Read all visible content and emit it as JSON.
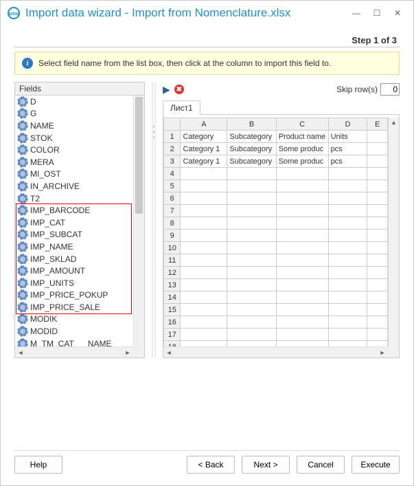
{
  "window": {
    "title": "Import data wizard - Import from Nomenclature.xlsx",
    "step_label": "Step 1 of 3"
  },
  "info": {
    "text": "Select field name from the list box, then click at the column to import this field to."
  },
  "fields": {
    "header": "Fields",
    "items": [
      "D",
      "G",
      "NAME",
      "STOK",
      "COLOR",
      "MERA",
      "MI_OST",
      "IN_ARCHIVE",
      "T2",
      "IMP_BARCODE",
      "IMP_CAT",
      "IMP_SUBCAT",
      "IMP_NAME",
      "IMP_SKLAD",
      "IMP_AMOUNT",
      "IMP_UNITS",
      "IMP_PRICE_POKUP",
      "IMP_PRICE_SALE",
      "MODIK",
      "MODID",
      "M_TM_CAT___NAME"
    ],
    "highlight_start_index": 9,
    "highlight_end_index": 17
  },
  "right": {
    "skip_label": "Skip row(s)",
    "skip_value": "0",
    "tab_label": "Лист1",
    "columns": [
      "A",
      "B",
      "C",
      "D",
      "E"
    ],
    "row_count": 19,
    "rows": [
      {
        "n": 1,
        "cells": [
          "Category",
          "Subcategory",
          "Product name",
          "Units",
          ""
        ]
      },
      {
        "n": 2,
        "cells": [
          "Category 1",
          "Subcategory",
          "Some produc",
          "pcs",
          ""
        ]
      },
      {
        "n": 3,
        "cells": [
          "Category 1",
          "Subcategory",
          "Some produc",
          "pcs",
          ""
        ]
      }
    ]
  },
  "buttons": {
    "help": "Help",
    "back": "< Back",
    "next": "Next >",
    "cancel": "Cancel",
    "execute": "Execute"
  }
}
